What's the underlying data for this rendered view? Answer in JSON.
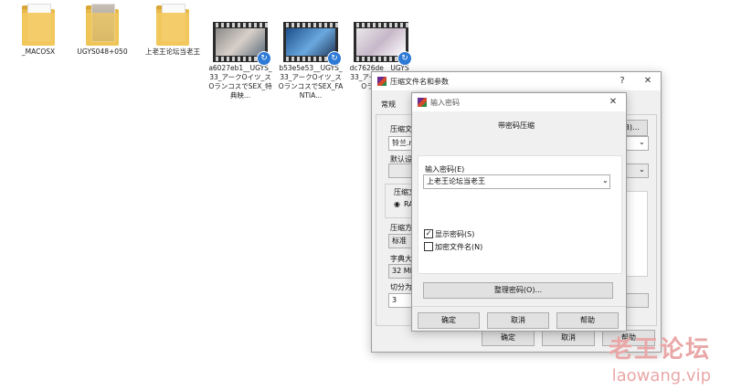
{
  "desktop": {
    "files": [
      {
        "name": "_MACOSX",
        "kind": "folder"
      },
      {
        "name": "UGYS048+050",
        "kind": "folder"
      },
      {
        "name": "上老王论坛当老王",
        "kind": "folder"
      },
      {
        "name": "a6027eb1__UGYS_33_アークOイツ_スOランコスでSEX_特典映...",
        "kind": "video"
      },
      {
        "name": "b53e5e53__UGYS_33_アークOイツ_スOランコスでSEX_FANTIA...",
        "kind": "video"
      },
      {
        "name": "dc7626de__UGYS_33_アークOイツ_スOランコスで",
        "kind": "video"
      }
    ]
  },
  "archive_dialog": {
    "title": "压缩文件名和参数",
    "help_symbol": "?",
    "close_symbol": "✕",
    "tab_general": "常规",
    "browse_button": "浏览(B)...",
    "label_archive_name": "压缩文",
    "archive_name_value": "铃兰.r",
    "label_default_profile": "默认设",
    "label_format": "压缩文",
    "radio_rar": "RA",
    "label_method": "压缩方",
    "method_value": "标准",
    "label_dict": "字典大",
    "dict_value": "32 MB",
    "label_split": "切分为",
    "split_value": "3",
    "ok": "确定",
    "cancel": "取消",
    "help": "帮助"
  },
  "password_dialog": {
    "title": "输入密码",
    "heading": "带密码压缩",
    "password_label": "输入密码(E)",
    "password_value": "上老王论坛当老王",
    "show_password_label": "显示密码(S)",
    "show_password_checked": "✓",
    "encrypt_names_label": "加密文件名(N)",
    "organize_button": "整理密码(O)...",
    "ok": "确定",
    "cancel": "取消",
    "help": "帮助",
    "close_symbol": "✕"
  },
  "watermark": {
    "line1": "老王论坛",
    "line2": "laowang.vip"
  }
}
